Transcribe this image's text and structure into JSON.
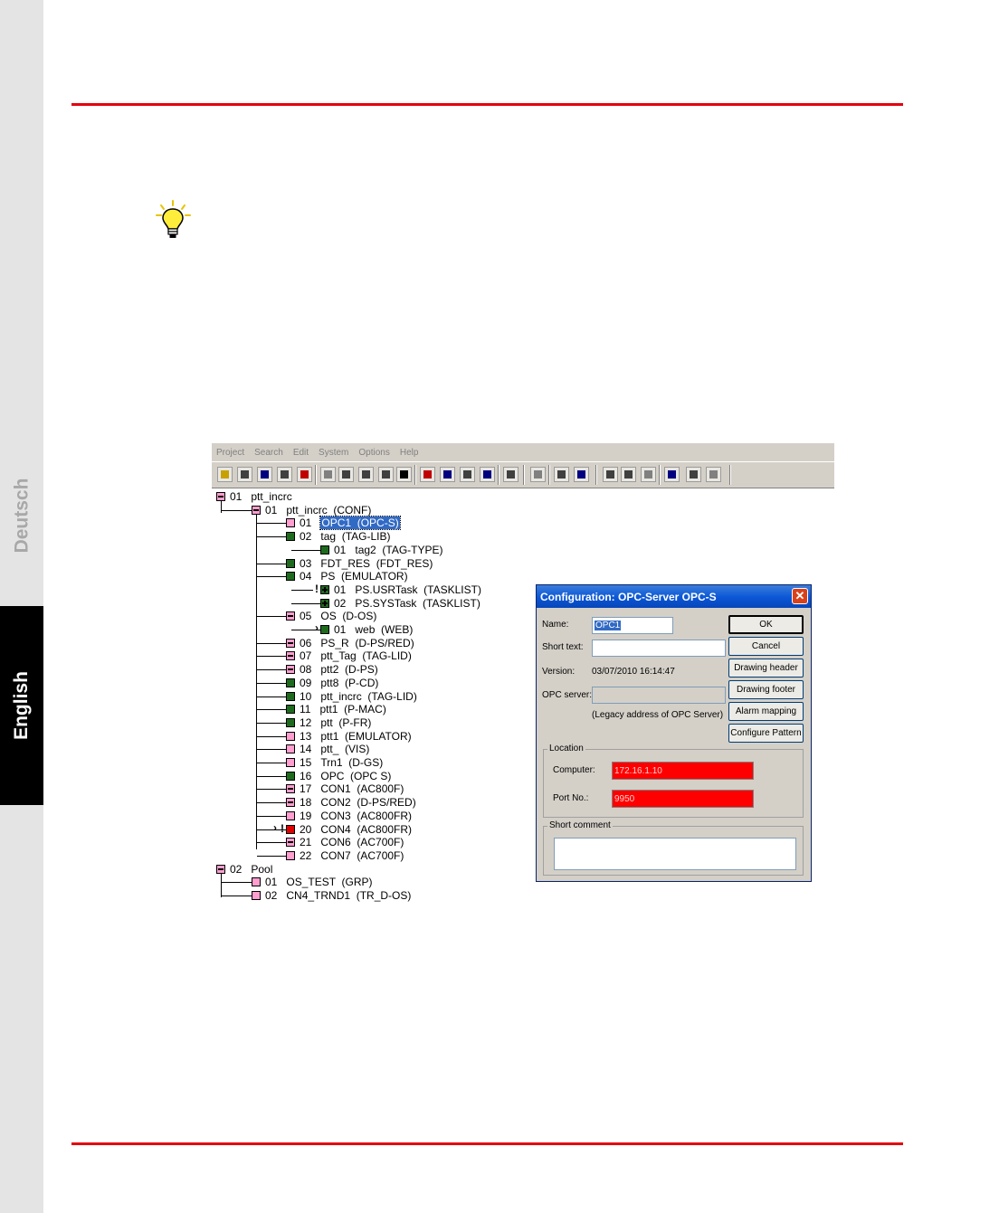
{
  "side_tabs": {
    "deutsch": "Deutsch",
    "english": "English"
  },
  "app": {
    "menu": [
      "Project",
      "Search",
      "Edit",
      "System",
      "Options",
      "Help"
    ],
    "toolbar_icons": [
      "open-icon",
      "new-icon",
      "save-icon",
      "print-preview-icon",
      "stop-icon",
      "undo-icon",
      "cut-icon",
      "copy-icon",
      "paste-icon",
      "delete-icon",
      "insert-icon",
      "insert-next-icon",
      "list-icon",
      "table-icon",
      "edit-icon",
      "back-icon",
      "print-icon",
      "help-icon",
      "tree-expand-icon",
      "tree-collapse-icon",
      "tree-node-icon",
      "upload-icon",
      "grid-icon",
      "user-icon"
    ],
    "tree": [
      {
        "num": "01",
        "text": "ptt_incrc",
        "box": "minus",
        "color": "#ff9ecf"
      },
      {
        "num": "01",
        "text": "ptt_incrc  (CONF)",
        "box": "minus",
        "color": "#ff9ecf"
      },
      {
        "num": "01",
        "text": "OPC1  (OPC-S)",
        "box": "none",
        "color": "#ff9ecf",
        "selected": true
      },
      {
        "num": "02",
        "text": "tag  (TAG-LIB)",
        "box": "none",
        "color": "#1e6b1e"
      },
      {
        "num": "01",
        "text": "tag2  (TAG-TYPE)",
        "box": "none",
        "color": "#1e6b1e"
      },
      {
        "num": "03",
        "text": "FDT_RES  (FDT_RES)",
        "box": "none",
        "color": "#1e6b1e"
      },
      {
        "num": "04",
        "text": "PS  (EMULATOR)",
        "box": "none",
        "color": "#1e6b1e"
      },
      {
        "num": "01",
        "text": "PS.USRTask  (TASKLIST)",
        "box": "plus",
        "color": "#1e6b1e",
        "mark": "!"
      },
      {
        "num": "02",
        "text": "PS.SYSTask  (TASKLIST)",
        "box": "plus",
        "color": "#1e6b1e"
      },
      {
        "num": "05",
        "text": "OS  (D-OS)",
        "box": "minus",
        "color": "#ff9ecf"
      },
      {
        "num": "01",
        "text": "web  (WEB)",
        "box": "none",
        "color": "#1e6b1e",
        "arrow": true
      },
      {
        "num": "06",
        "text": "PS_R  (D-PS/RED)",
        "box": "minus",
        "color": "#ff9ecf"
      },
      {
        "num": "07",
        "text": "ptt_Tag  (TAG-LID)",
        "box": "minus",
        "color": "#ff9ecf"
      },
      {
        "num": "08",
        "text": "ptt2  (D-PS)",
        "box": "minus",
        "color": "#ff9ecf"
      },
      {
        "num": "09",
        "text": "ptt8  (P-CD)",
        "box": "none",
        "color": "#1e6b1e"
      },
      {
        "num": "10",
        "text": "ptt_incrc  (TAG-LID)",
        "box": "none",
        "color": "#1e6b1e"
      },
      {
        "num": "11",
        "text": "ptt1  (P-MAC)",
        "box": "none",
        "color": "#1e6b1e"
      },
      {
        "num": "12",
        "text": "ptt  (P-FR)",
        "box": "none",
        "color": "#1e6b1e"
      },
      {
        "num": "13",
        "text": "ptt1  (EMULATOR)",
        "box": "none",
        "color": "#ff9ecf"
      },
      {
        "num": "14",
        "text": "ptt_  (VIS)",
        "box": "none",
        "color": "#ff9ecf"
      },
      {
        "num": "15",
        "text": "Trn1  (D-GS)",
        "box": "none",
        "color": "#ff9ecf"
      },
      {
        "num": "16",
        "text": "OPC  (OPC S)",
        "box": "none",
        "color": "#1e6b1e"
      },
      {
        "num": "17",
        "text": "CON1  (AC800F)",
        "box": "minus",
        "color": "#ff9ecf"
      },
      {
        "num": "18",
        "text": "CON2  (D-PS/RED)",
        "box": "minus",
        "color": "#ff9ecf"
      },
      {
        "num": "19",
        "text": "CON3  (AC800FR)",
        "box": "none",
        "color": "#ff9ecf"
      },
      {
        "num": "20",
        "text": "CON4  (AC800FR)",
        "box": "none",
        "color": "#e00000",
        "mark": "!",
        "arrow": true
      },
      {
        "num": "21",
        "text": "CON6  (AC700F)",
        "box": "minus",
        "color": "#ff9ecf"
      },
      {
        "num": "22",
        "text": "CON7  (AC700F)",
        "box": "none",
        "color": "#ff9ecf"
      },
      {
        "num": "02",
        "text": "Pool",
        "box": "minus",
        "color": "#ff9ecf"
      },
      {
        "num": "01",
        "text": "OS_TEST  (GRP)",
        "box": "none",
        "color": "#ff9ecf"
      },
      {
        "num": "02",
        "text": "CN4_TRND1  (TR_D-OS)",
        "box": "none",
        "color": "#ff9ecf"
      }
    ]
  },
  "dialog": {
    "title": "Configuration: OPC-Server OPC-S",
    "name_label": "Name:",
    "name_value": "OPC1",
    "short_text_label": "Short text:",
    "short_text_value": "",
    "version_label": "Version:",
    "version_value": "03/07/2010 16:14:47",
    "opc_server_label": "OPC server:",
    "opc_server_value": "",
    "legacy_note": "(Legacy address of OPC Server)",
    "buttons": {
      "ok": "OK",
      "cancel": "Cancel",
      "drawing_header": "Drawing header",
      "drawing_footer": "Drawing footer",
      "alarm_mapping": "Alarm mapping",
      "configure_pattern": "Configure Pattern"
    },
    "location_title": "Location",
    "computer_label": "Computer:",
    "computer_value": "172.16.1.10",
    "port_label": "Port No.:",
    "port_value": "9950",
    "comment_title": "Short comment",
    "comment_value": "",
    "field_highlight": "#ff0000"
  },
  "colors": {
    "accent_rule": "#e3000f",
    "tree_pink": "#ff9ecf",
    "tree_green": "#1e6b1e",
    "tree_red": "#e00000"
  }
}
